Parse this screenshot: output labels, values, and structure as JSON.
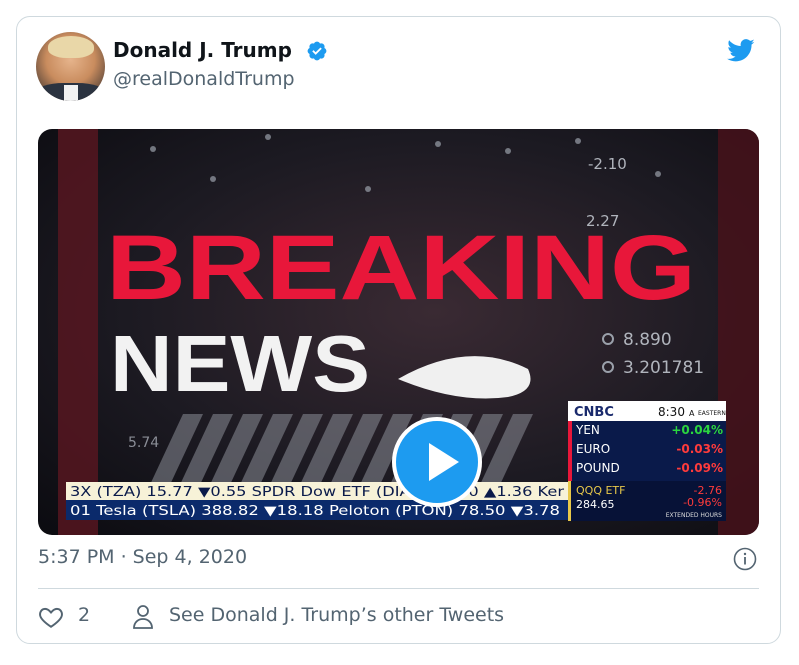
{
  "tweet": {
    "author_name": "Donald J. Trump",
    "handle": "@realDonaldTrump",
    "timestamp": "5:37 PM · Sep 4, 2020",
    "like_count": "2",
    "other_tweets_label": "See Donald J. Trump’s other Tweets"
  },
  "media": {
    "headline_top": "BREAKING",
    "headline_bottom": "NEWS",
    "bg_numbers": {
      "n1": "-2.10",
      "n2": "2.27",
      "n3": "8.890",
      "n4": "3.201781",
      "n5": "5.74"
    },
    "network": {
      "logo": "CNBC",
      "time": "8:30",
      "time_suffix": "A",
      "zone": "EASTERN",
      "rows": [
        {
          "label": "YEN",
          "value": "+0.04%",
          "color": "#2bd63f"
        },
        {
          "label": "EURO",
          "value": "-0.03%",
          "color": "#ff3b3b"
        },
        {
          "label": "POUND",
          "value": "-0.09%",
          "color": "#ff3b3b"
        }
      ],
      "qqq_label": "QQQ ETF",
      "qqq_price": "284.65",
      "qqq_change": "-2.76",
      "qqq_pct": "-0.96%",
      "extended": "EXTENDED HOURS"
    },
    "ticker_top": "3X (TZA) 15.77 ▼0.55   SPDR Dow ETF (DIA) 284.70 ▲1.36   Ker",
    "ticker_bottom": "01   Tesla (TSLA) 388.82 ▼18.18   Peloton (PTON) 78.50 ▼3.78"
  },
  "colors": {
    "accent": "#1d9bf0",
    "text_secondary": "#536471",
    "breaking_red": "#e8173a"
  },
  "icons": [
    "verified-badge-icon",
    "twitter-bird-icon",
    "play-icon",
    "info-icon",
    "heart-icon",
    "person-icon"
  ]
}
